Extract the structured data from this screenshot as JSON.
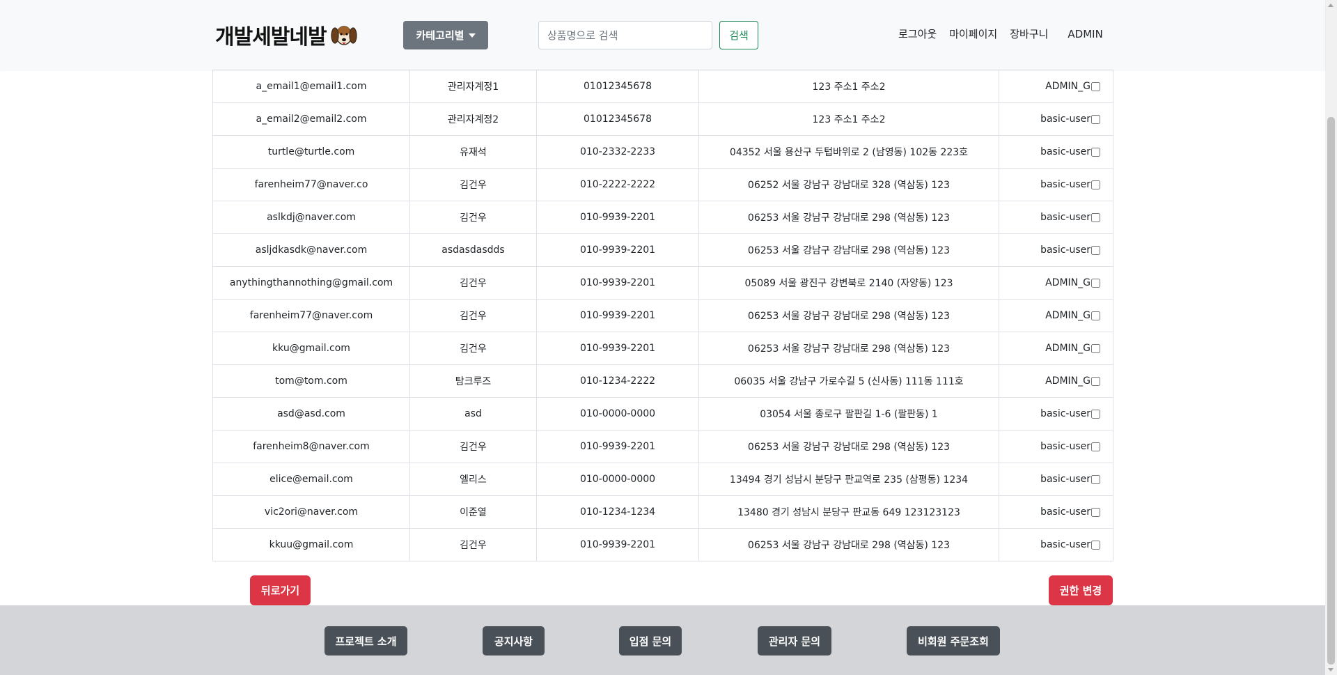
{
  "header": {
    "logo_text": "개발세발네발",
    "category_label": "카테고리별",
    "search_placeholder": "상품명으로 검색",
    "search_button": "검색",
    "nav": [
      "로그아웃",
      "마이페이지",
      "장바구니",
      "ADMIN"
    ]
  },
  "users": [
    {
      "email": "a_email1@email1.com",
      "name": "관리자계정1",
      "phone": "01012345678",
      "address": "123 주소1 주소2",
      "role": "ADMIN_G"
    },
    {
      "email": "a_email2@email2.com",
      "name": "관리자계정2",
      "phone": "01012345678",
      "address": "123 주소1 주소2",
      "role": "basic-user"
    },
    {
      "email": "turtle@turtle.com",
      "name": "유재석",
      "phone": "010-2332-2233",
      "address": "04352 서울 용산구 두텁바위로 2 (남영동) 102동 223호",
      "role": "basic-user"
    },
    {
      "email": "farenheim77@naver.co",
      "name": "김건우",
      "phone": "010-2222-2222",
      "address": "06252 서울 강남구 강남대로 328 (역삼동) 123",
      "role": "basic-user"
    },
    {
      "email": "aslkdj@naver.com",
      "name": "김건우",
      "phone": "010-9939-2201",
      "address": "06253 서울 강남구 강남대로 298 (역삼동) 123",
      "role": "basic-user"
    },
    {
      "email": "asljdkasdk@naver.com",
      "name": "asdasdasdds",
      "phone": "010-9939-2201",
      "address": "06253 서울 강남구 강남대로 298 (역삼동) 123",
      "role": "basic-user"
    },
    {
      "email": "anythingthannothing@gmail.com",
      "name": "김건우",
      "phone": "010-9939-2201",
      "address": "05089 서울 광진구 강변북로 2140 (자양동) 123",
      "role": "ADMIN_G"
    },
    {
      "email": "farenheim77@naver.com",
      "name": "김건우",
      "phone": "010-9939-2201",
      "address": "06253 서울 강남구 강남대로 298 (역삼동) 123",
      "role": "ADMIN_G"
    },
    {
      "email": "kku@gmail.com",
      "name": "김건우",
      "phone": "010-9939-2201",
      "address": "06253 서울 강남구 강남대로 298 (역삼동) 123",
      "role": "ADMIN_G"
    },
    {
      "email": "tom@tom.com",
      "name": "탐크루즈",
      "phone": "010-1234-2222",
      "address": "06035 서울 강남구 가로수길 5 (신사동) 111동 111호",
      "role": "ADMIN_G"
    },
    {
      "email": "asd@asd.com",
      "name": "asd",
      "phone": "010-0000-0000",
      "address": "03054 서울 종로구 팔판길 1-6 (팔판동) 1",
      "role": "basic-user"
    },
    {
      "email": "farenheim8@naver.com",
      "name": "김건우",
      "phone": "010-9939-2201",
      "address": "06253 서울 강남구 강남대로 298 (역삼동) 123",
      "role": "basic-user"
    },
    {
      "email": "elice@email.com",
      "name": "엘리스",
      "phone": "010-0000-0000",
      "address": "13494 경기 성남시 분당구 판교역로 235 (삼평동) 1234",
      "role": "basic-user"
    },
    {
      "email": "vic2ori@naver.com",
      "name": "이준열",
      "phone": "010-1234-1234",
      "address": "13480 경기 성남시 분당구 판교동 649 123123123",
      "role": "basic-user"
    },
    {
      "email": "kkuu@gmail.com",
      "name": "김건우",
      "phone": "010-9939-2201",
      "address": "06253 서울 강남구 강남대로 298 (역삼동) 123",
      "role": "basic-user"
    }
  ],
  "actions": {
    "back_label": "뒤로가기",
    "change_auth_label": "권한 변경"
  },
  "footer": {
    "buttons": [
      "프로젝트 소개",
      "공지사항",
      "입점 문의",
      "관리자 문의",
      "비회원 주문조회"
    ]
  },
  "colors": {
    "header_bg": "#f8f9fa",
    "category_button": "#6c757d",
    "search_button": "#198754",
    "danger": "#dc3545",
    "footer_bg": "#d3d5d8",
    "footer_button": "#495057"
  },
  "icons": {
    "logo": "beagle-dog-icon",
    "category": "caret-down-icon"
  }
}
